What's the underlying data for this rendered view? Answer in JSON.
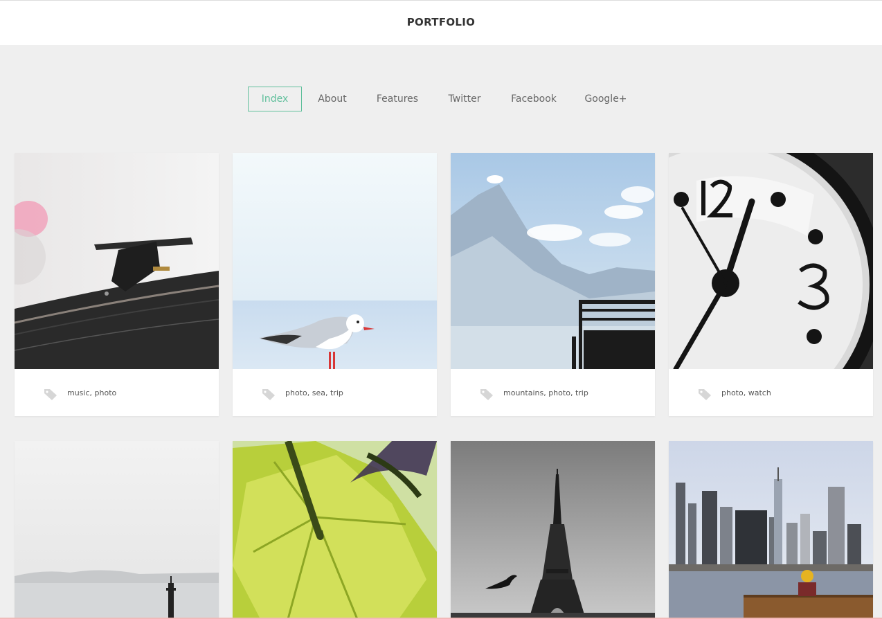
{
  "header": {
    "brand": "PORTFOLIO"
  },
  "nav": {
    "items": [
      {
        "label": "Index",
        "active": true
      },
      {
        "label": "About"
      },
      {
        "label": "Features"
      },
      {
        "label": "Twitter"
      },
      {
        "label": "Facebook"
      },
      {
        "label": "Google+"
      }
    ]
  },
  "cards": [
    {
      "image": "turntable-photo",
      "tags": [
        "music",
        "photo"
      ]
    },
    {
      "image": "seagull-photo",
      "tags": [
        "photo",
        "sea",
        "trip"
      ]
    },
    {
      "image": "mountains-photo",
      "tags": [
        "mountains",
        "photo",
        "trip"
      ]
    },
    {
      "image": "clock-photo",
      "tags": [
        "photo",
        "watch"
      ]
    },
    {
      "image": "sea-buoy-photo",
      "tags": []
    },
    {
      "image": "green-leaf-photo",
      "tags": []
    },
    {
      "image": "eiffel-tower-photo",
      "tags": []
    },
    {
      "image": "city-skyline-photo",
      "tags": []
    }
  ],
  "tag_separator": ", ",
  "colors": {
    "accent": "#5fbf9b",
    "background": "#efefef",
    "card": "#ffffff"
  },
  "icons": {
    "tag": "tag-icon"
  }
}
